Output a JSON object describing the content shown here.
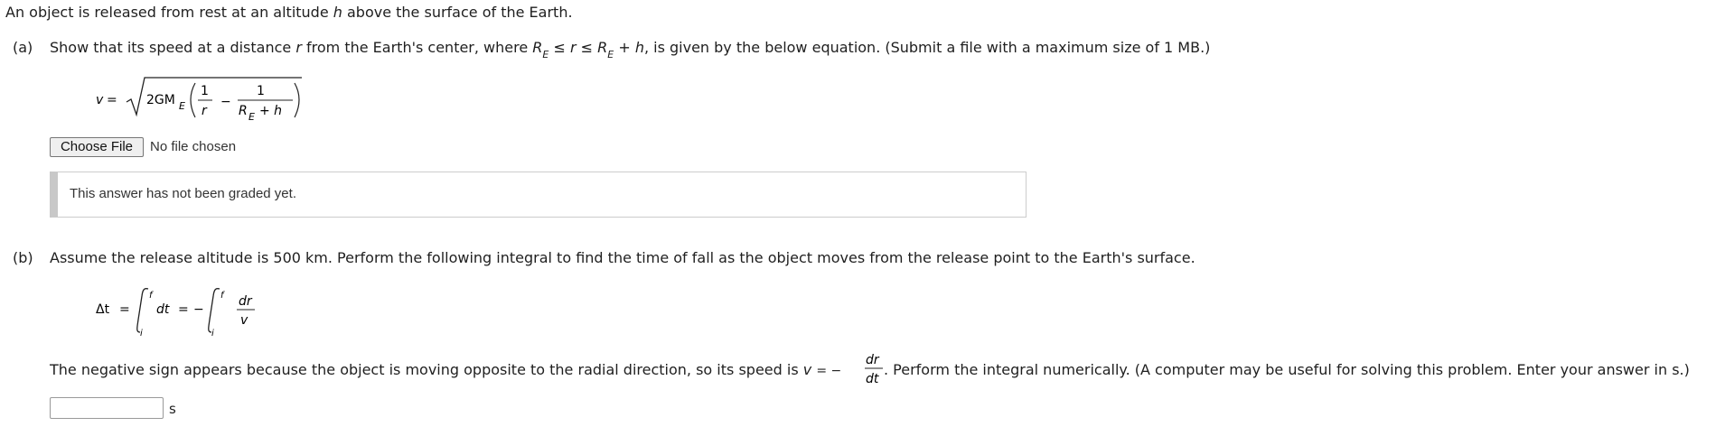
{
  "intro": "An object is released from rest at an altitude h above the surface of the Earth.",
  "part_a": {
    "label": "(a)",
    "text_before_r": "Show that its speed at a distance",
    "r": "r",
    "text_mid": "from the Earth's center, where",
    "R": "R",
    "E": "E",
    "le1": "≤",
    "r2": "r",
    "le2": "≤",
    "plus": "+",
    "h": "h",
    "text_after": ", is given by the below equation. (Submit a file with a maximum size of 1 MB.)",
    "equation": {
      "lhs": "v",
      "eq": "=",
      "coef": "2GM",
      "coef_sub": "E",
      "num1": "1",
      "den1": "r",
      "minus": "−",
      "num2": "1",
      "den2_R": "R",
      "den2_sub": "E",
      "den2_rest": "+ h"
    },
    "file_button_label": "Choose File",
    "file_status": "No file chosen",
    "grade_status": "This answer has not been graded yet."
  },
  "part_b": {
    "label": "(b)",
    "prompt": "Assume the release altitude is 500 km. Perform the following integral to find the time of fall as the object moves from the release point to the Earth's surface.",
    "equation": {
      "lhs": "Δt",
      "eq": "=",
      "upper": "f",
      "lower": "i",
      "integrand1": "dt",
      "eq2": "=",
      "neg": "−",
      "frac_num": "dr",
      "frac_den": "v"
    },
    "explanation_before": "The negative sign appears because the object is moving opposite to the radial direction, so its speed is",
    "speed_v": "v",
    "speed_eq": "= −",
    "speed_num": "dr",
    "speed_den": "dt",
    "explanation_after": ". Perform the integral numerically. (A computer may be useful for solving this problem. Enter your answer in s.)",
    "answer_value": "",
    "unit": "s"
  }
}
